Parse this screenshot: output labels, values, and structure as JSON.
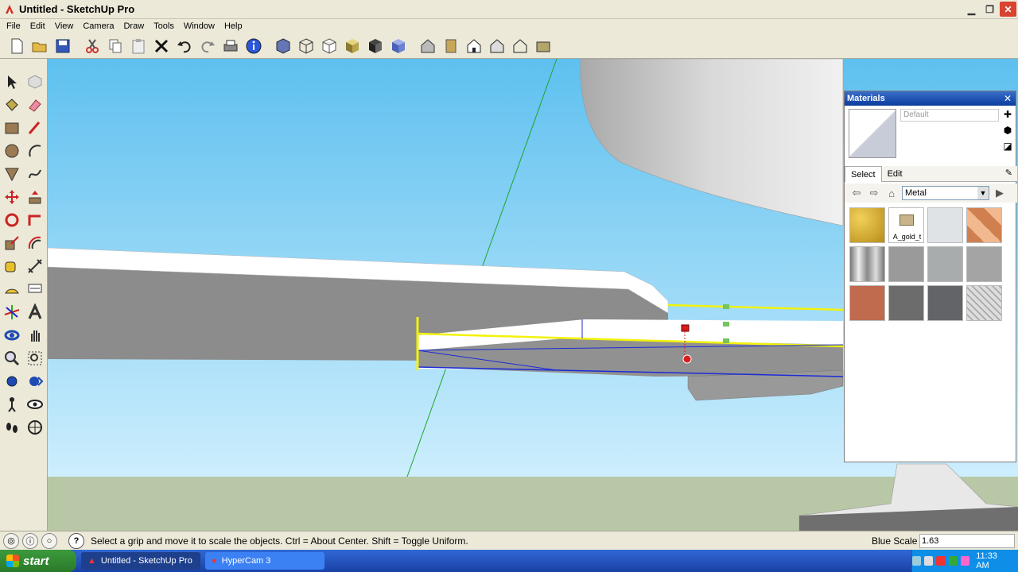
{
  "window": {
    "title": "Untitled - SketchUp Pro"
  },
  "menu": {
    "items": [
      "File",
      "Edit",
      "View",
      "Camera",
      "Draw",
      "Tools",
      "Window",
      "Help"
    ]
  },
  "materials_panel": {
    "title": "Materials",
    "name_field": "Default",
    "tabs": {
      "select": "Select",
      "edit": "Edit"
    },
    "library": "Metal",
    "swatches": [
      {
        "name": "gold-texture",
        "color": "#d8a82a"
      },
      {
        "name": "folder",
        "label": "A_gold_t",
        "color": "#ffffff"
      },
      {
        "name": "light-aluminum",
        "color": "#dfe3e6"
      },
      {
        "name": "copper-diamond",
        "color": "#e8a070"
      },
      {
        "name": "brushed-steel",
        "color": "#b0b0b0"
      },
      {
        "name": "steel-cross",
        "color": "#9a9a9a"
      },
      {
        "name": "dark-aluminum",
        "color": "#a8acac"
      },
      {
        "name": "gray-metal",
        "color": "#a4a4a4"
      },
      {
        "name": "rust",
        "color": "#c06a4e"
      },
      {
        "name": "dark-steel",
        "color": "#6c6c6c"
      },
      {
        "name": "dark-mesh",
        "color": "#636468"
      },
      {
        "name": "diamond-plate",
        "color": "#d8d8d8"
      }
    ]
  },
  "status": {
    "message": "Select a grip and move it to scale the objects. Ctrl = About Center. Shift = Toggle Uniform.",
    "vcb_label": "Blue Scale",
    "vcb_value": "1.63"
  },
  "taskbar": {
    "start": "start",
    "tasks": [
      "Untitled - SketchUp Pro",
      "HyperCam 3"
    ],
    "clock": "11:33 AM"
  }
}
